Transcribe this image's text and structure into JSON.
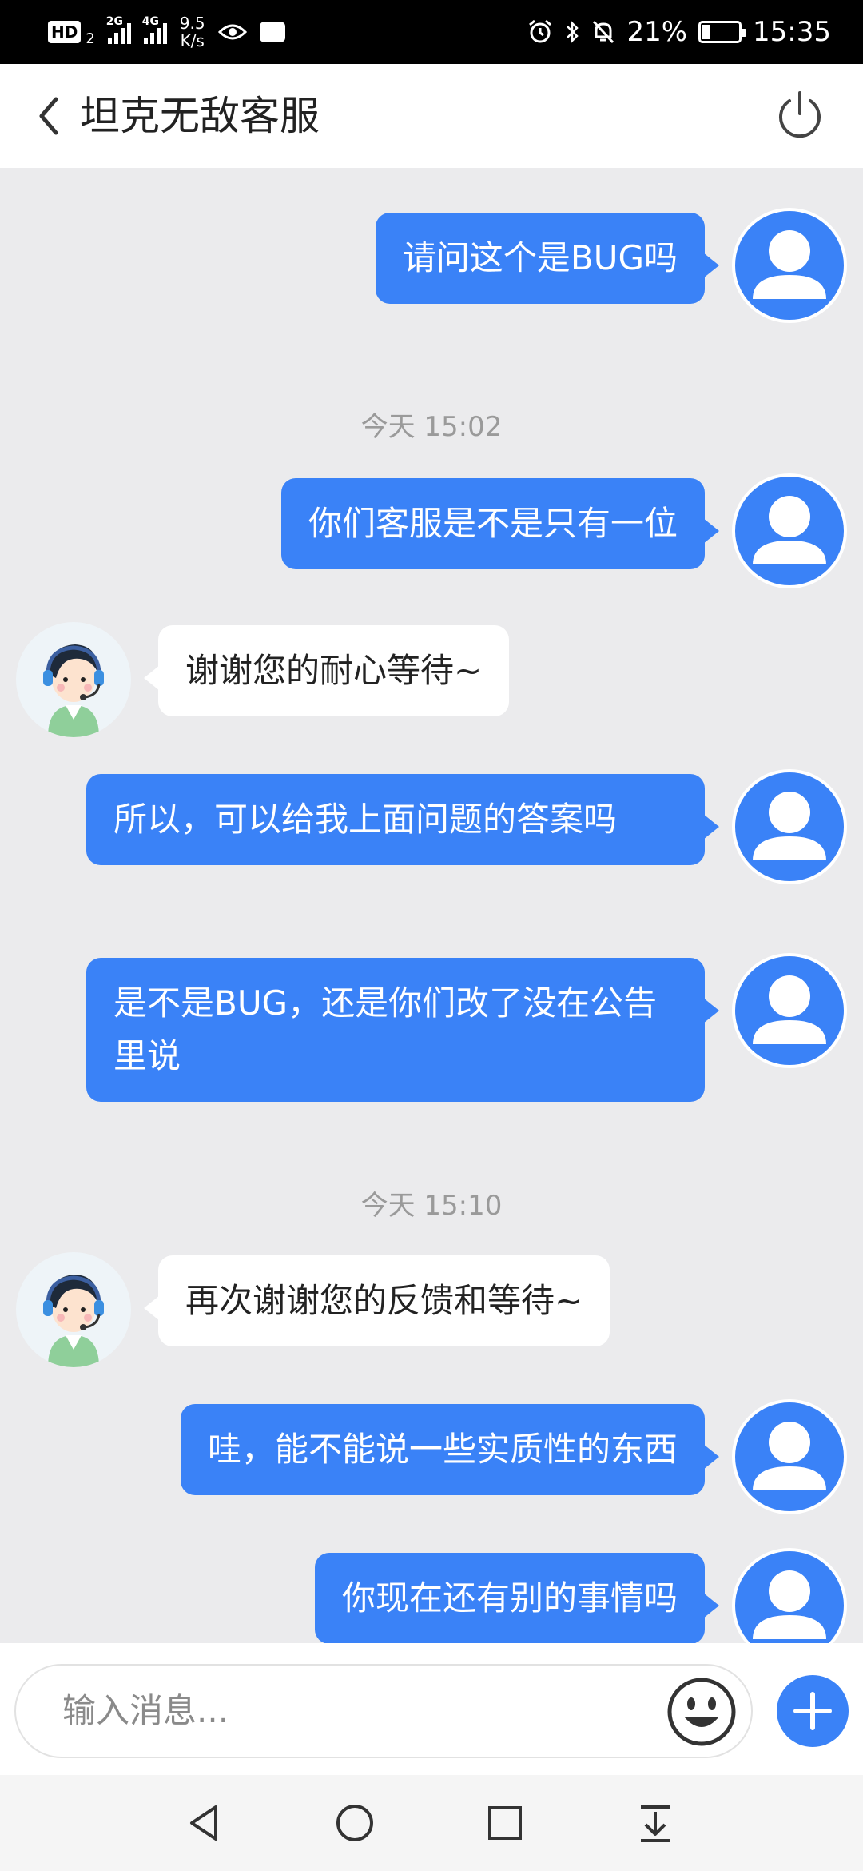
{
  "status_bar": {
    "hd_label": "HD",
    "hd_sub": "2",
    "signal1_tag": "2G",
    "signal2_tag": "4G",
    "net_speed_value": "9.5",
    "net_speed_unit": "K/s",
    "battery_percent": "21%",
    "time": "15:35",
    "battery_level": 0.21,
    "icons": [
      "hd-icon",
      "signal-icon",
      "signal-icon",
      "eye-icon",
      "app-icon",
      "alarm-icon",
      "bluetooth-icon",
      "mute-icon",
      "battery-icon"
    ]
  },
  "header": {
    "title": "坦克无敌客服",
    "back_icon": "chevron-left-icon",
    "power_icon": "power-icon"
  },
  "messages": [
    {
      "from": "me",
      "text": "请问这个是BUG吗"
    },
    {
      "timestamp": "今天 15:02"
    },
    {
      "from": "me",
      "text": "你们客服是不是只有一位"
    },
    {
      "from": "agent",
      "text": "谢谢您的耐心等待~"
    },
    {
      "from": "me",
      "text": "所以，可以给我上面问题的答案吗"
    },
    {
      "from": "me",
      "text": "是不是BUG，还是你们改了没在公告里说"
    },
    {
      "timestamp": "今天 15:10"
    },
    {
      "from": "agent",
      "text": "再次谢谢您的反馈和等待~"
    },
    {
      "from": "me",
      "text": "哇，能不能说一些实质性的东西"
    },
    {
      "from": "me",
      "text": "你现在还有别的事情吗"
    }
  ],
  "input": {
    "placeholder": "输入消息...",
    "emoji_icon": "smiley-icon",
    "add_icon": "plus-icon"
  },
  "nav": {
    "icons": [
      "back-triangle-icon",
      "home-circle-icon",
      "recents-square-icon",
      "notification-pull-icon"
    ]
  },
  "colors": {
    "accent": "#3a82f7",
    "chat_bg": "#ebebed",
    "timestamp": "#9a9a9a"
  }
}
